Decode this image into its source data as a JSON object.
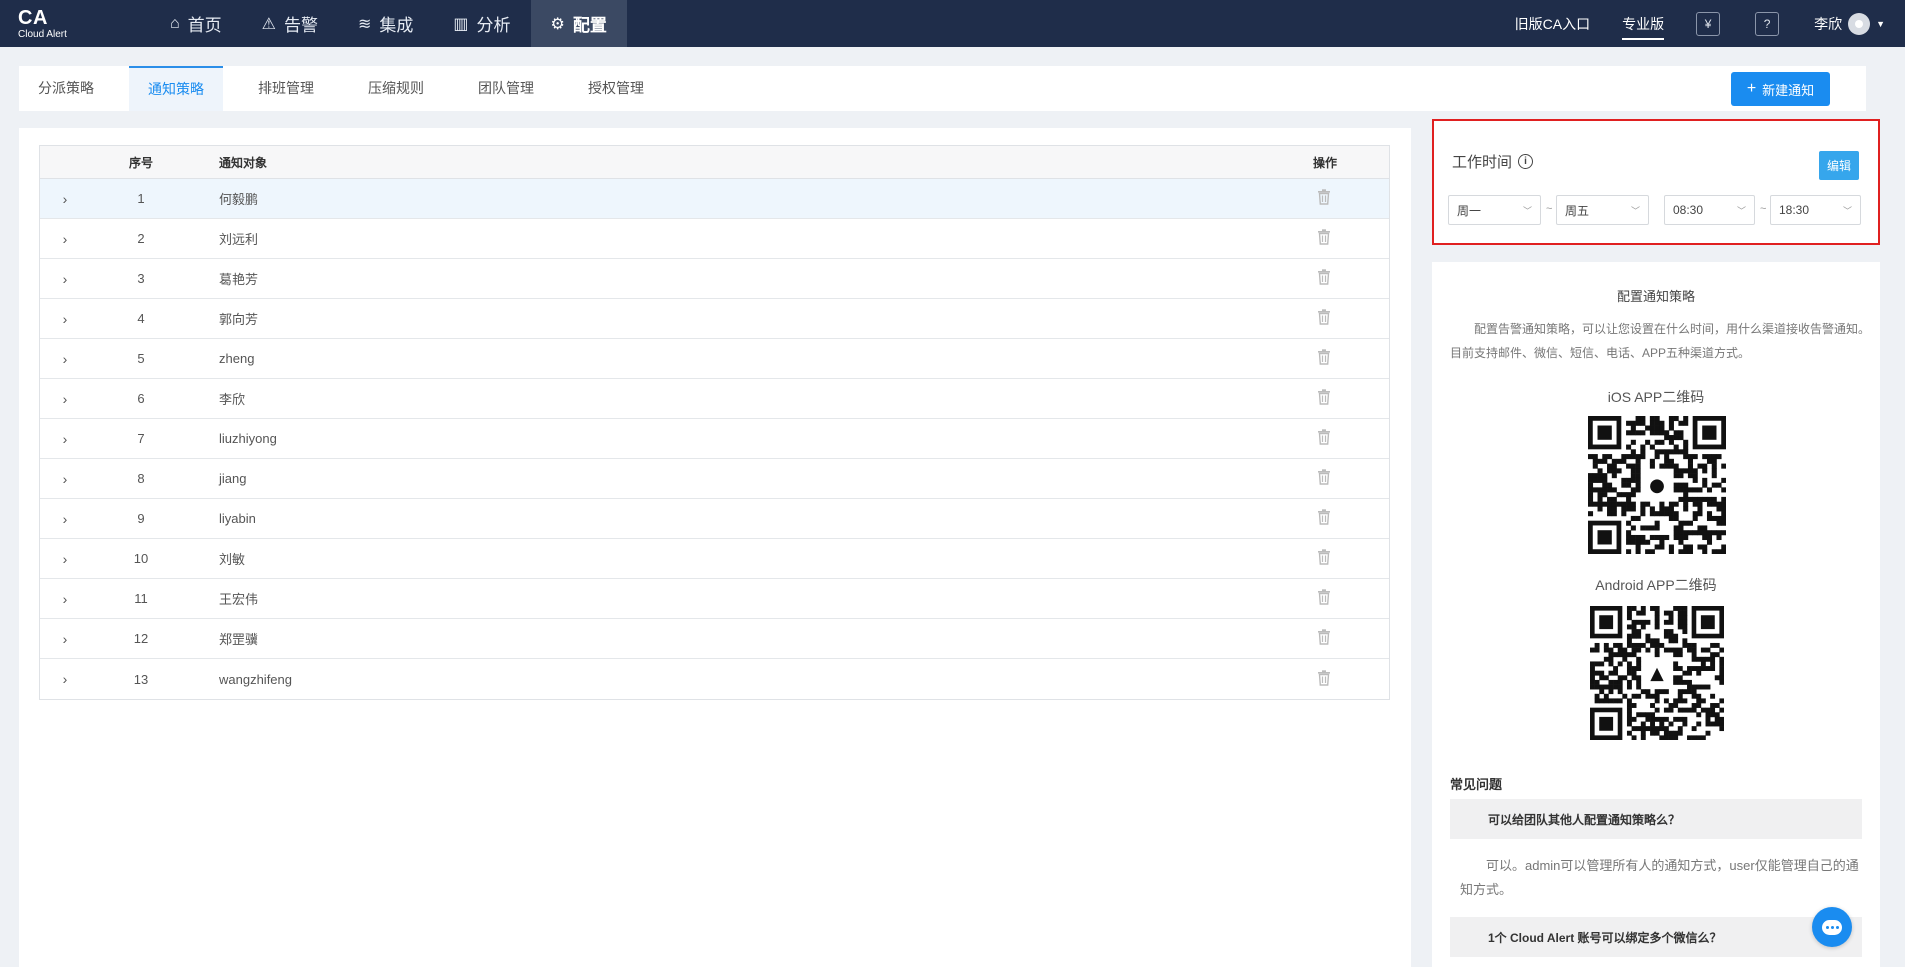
{
  "brand": {
    "logo": "CA",
    "sub": "Cloud Alert"
  },
  "nav": {
    "items": [
      {
        "label": "首页",
        "icon": "home-icon",
        "glyph": "⌂"
      },
      {
        "label": "告警",
        "icon": "alarm-light-icon",
        "glyph": "⚠"
      },
      {
        "label": "集成",
        "icon": "layers-icon",
        "glyph": "≋"
      },
      {
        "label": "分析",
        "icon": "bar-chart-icon",
        "glyph": "▥"
      },
      {
        "label": "配置",
        "icon": "gear-icon",
        "glyph": "⚙"
      }
    ],
    "legacy": "旧版CA入口",
    "pro": "专业版",
    "billing_glyph": "¥",
    "help_glyph": "?",
    "user": "李欣"
  },
  "tabs": [
    "分派策略",
    "通知策略",
    "排班管理",
    "压缩规则",
    "团队管理",
    "授权管理"
  ],
  "new_button": "新建通知",
  "table": {
    "headers": {
      "index": "序号",
      "target": "通知对象",
      "action": "操作"
    },
    "rows": [
      {
        "index": "1",
        "name": "何毅鹏"
      },
      {
        "index": "2",
        "name": "刘远利"
      },
      {
        "index": "3",
        "name": "葛艳芳"
      },
      {
        "index": "4",
        "name": "郭向芳"
      },
      {
        "index": "5",
        "name": "zheng"
      },
      {
        "index": "6",
        "name": "李欣"
      },
      {
        "index": "7",
        "name": "liuzhiyong"
      },
      {
        "index": "8",
        "name": "jiang"
      },
      {
        "index": "9",
        "name": "liyabin"
      },
      {
        "index": "10",
        "name": "刘敏"
      },
      {
        "index": "11",
        "name": "王宏伟"
      },
      {
        "index": "12",
        "name": "郑罡骥"
      },
      {
        "index": "13",
        "name": "wangzhifeng"
      }
    ]
  },
  "worktime": {
    "title": "工作时间",
    "edit": "编辑",
    "day_from": "周一",
    "day_to": "周五",
    "time_from": "08:30",
    "time_to": "18:30",
    "sep": "~"
  },
  "help": {
    "title": "配置通知策略",
    "desc": "配置告警通知策略，可以让您设置在什么时间，用什么渠道接收告警通知。目前支持邮件、微信、短信、电话、APP五种渠道方式。",
    "ios_label": "iOS APP二维码",
    "android_label": "Android APP二维码",
    "faq_title": "常见问题",
    "faq": [
      {
        "q": "可以给团队其他人配置通知策略么？",
        "a": "可以。admin可以管理所有人的通知方式，user仅能管理自己的通知方式。"
      },
      {
        "q": "1个 Cloud Alert 账号可以绑定多个微信么？"
      }
    ]
  },
  "colors": {
    "nav_bg": "#1f2d4a",
    "accent": "#1a8cf0",
    "highlight_border": "#e02020"
  }
}
